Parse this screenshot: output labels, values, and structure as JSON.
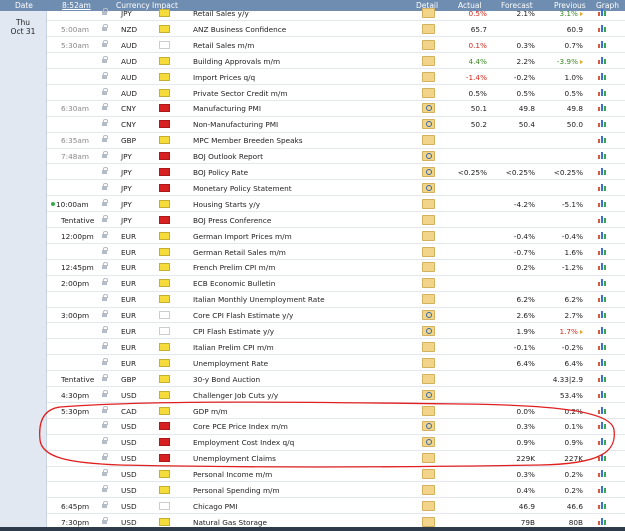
{
  "header": {
    "date_label": "Date",
    "time_label": "8:52am",
    "currency_label": "Currency",
    "impact_label": "Impact",
    "detail_label": "Detail",
    "actual_label": "Actual",
    "forecast_label": "Forecast",
    "previous_label": "Previous",
    "graph_label": "Graph"
  },
  "day": {
    "weekday": "Thu",
    "date": "Oct 31"
  },
  "colors": {
    "impact_low": "#f5dc3a",
    "impact_medium": "#f0903a",
    "impact_high": "#d72020",
    "better": "#3a8a24",
    "worse": "#d0281b",
    "header_bg": "#6f8db0",
    "annotation": "#e02020"
  },
  "events": [
    {
      "time": "",
      "currency": "JPY",
      "impact": "low",
      "event": "Retail Sales y/y",
      "actual": "0.5%",
      "actual_color": "red",
      "forecast": "2.1%",
      "previous": "3.1%",
      "previous_color": "green",
      "revised": true,
      "detail": "folder"
    },
    {
      "time": "5:00am",
      "currency": "NZD",
      "impact": "low",
      "event": "ANZ Business Confidence",
      "actual": "65.7",
      "actual_color": "",
      "forecast": "",
      "previous": "60.9",
      "previous_color": "",
      "revised": false,
      "detail": "folder"
    },
    {
      "time": "5:30am",
      "currency": "AUD",
      "impact": "medium",
      "event": "Retail Sales m/m",
      "actual": "0.1%",
      "actual_color": "red",
      "forecast": "0.3%",
      "previous": "0.7%",
      "previous_color": "",
      "revised": false,
      "detail": "folder"
    },
    {
      "time": "",
      "currency": "AUD",
      "impact": "low",
      "event": "Building Approvals m/m",
      "actual": "4.4%",
      "actual_color": "green",
      "forecast": "2.2%",
      "previous": "-3.9%",
      "previous_color": "green",
      "revised": true,
      "detail": "folder"
    },
    {
      "time": "",
      "currency": "AUD",
      "impact": "low",
      "event": "Import Prices q/q",
      "actual": "-1.4%",
      "actual_color": "red",
      "forecast": "-0.2%",
      "previous": "1.0%",
      "previous_color": "",
      "revised": false,
      "detail": "folder"
    },
    {
      "time": "",
      "currency": "AUD",
      "impact": "low",
      "event": "Private Sector Credit m/m",
      "actual": "0.5%",
      "actual_color": "",
      "forecast": "0.5%",
      "previous": "0.5%",
      "previous_color": "",
      "revised": false,
      "detail": "folder"
    },
    {
      "time": "6:30am",
      "currency": "CNY",
      "impact": "high",
      "event": "Manufacturing PMI",
      "actual": "50.1",
      "actual_color": "",
      "forecast": "49.8",
      "previous": "49.8",
      "previous_color": "",
      "revised": false,
      "detail": "magnifier"
    },
    {
      "time": "",
      "currency": "CNY",
      "impact": "high",
      "event": "Non-Manufacturing PMI",
      "actual": "50.2",
      "actual_color": "",
      "forecast": "50.4",
      "previous": "50.0",
      "previous_color": "",
      "revised": false,
      "detail": "magnifier"
    },
    {
      "time": "6:35am",
      "currency": "GBP",
      "impact": "low",
      "event": "MPC Member Breeden Speaks",
      "actual": "",
      "actual_color": "",
      "forecast": "",
      "previous": "",
      "previous_color": "",
      "revised": false,
      "detail": "folder"
    },
    {
      "time": "7:48am",
      "currency": "JPY",
      "impact": "high",
      "event": "BOJ Outlook Report",
      "actual": "",
      "actual_color": "",
      "forecast": "",
      "previous": "",
      "previous_color": "",
      "revised": false,
      "detail": "magnifier"
    },
    {
      "time": "",
      "currency": "JPY",
      "impact": "high",
      "event": "BOJ Policy Rate",
      "actual": "<0.25%",
      "actual_color": "",
      "forecast": "<0.25%",
      "previous": "<0.25%",
      "previous_color": "",
      "revised": false,
      "detail": "magnifier"
    },
    {
      "time": "",
      "currency": "JPY",
      "impact": "high",
      "event": "Monetary Policy Statement",
      "actual": "",
      "actual_color": "",
      "forecast": "",
      "previous": "",
      "previous_color": "",
      "revised": false,
      "detail": "magnifier"
    },
    {
      "time": "10:00am",
      "currency": "JPY",
      "impact": "low",
      "event": "Housing Starts y/y",
      "actual": "",
      "actual_color": "",
      "forecast": "-4.2%",
      "previous": "-5.1%",
      "previous_color": "",
      "revised": false,
      "detail": "folder",
      "upcoming": true
    },
    {
      "time": "Tentative",
      "currency": "JPY",
      "impact": "high",
      "event": "BOJ Press Conference",
      "actual": "",
      "actual_color": "",
      "forecast": "",
      "previous": "",
      "previous_color": "",
      "revised": false,
      "detail": "folder"
    },
    {
      "time": "12:00pm",
      "currency": "EUR",
      "impact": "low",
      "event": "German Import Prices m/m",
      "actual": "",
      "actual_color": "",
      "forecast": "-0.4%",
      "previous": "-0.4%",
      "previous_color": "",
      "revised": false,
      "detail": "folder"
    },
    {
      "time": "",
      "currency": "EUR",
      "impact": "low",
      "event": "German Retail Sales m/m",
      "actual": "",
      "actual_color": "",
      "forecast": "-0.7%",
      "previous": "1.6%",
      "previous_color": "",
      "revised": false,
      "detail": "folder"
    },
    {
      "time": "12:45pm",
      "currency": "EUR",
      "impact": "low",
      "event": "French Prelim CPI m/m",
      "actual": "",
      "actual_color": "",
      "forecast": "0.2%",
      "previous": "-1.2%",
      "previous_color": "",
      "revised": false,
      "detail": "folder"
    },
    {
      "time": "2:00pm",
      "currency": "EUR",
      "impact": "low",
      "event": "ECB Economic Bulletin",
      "actual": "",
      "actual_color": "",
      "forecast": "",
      "previous": "",
      "previous_color": "",
      "revised": false,
      "detail": "folder"
    },
    {
      "time": "",
      "currency": "EUR",
      "impact": "low",
      "event": "Italian Monthly Unemployment Rate",
      "actual": "",
      "actual_color": "",
      "forecast": "6.2%",
      "previous": "6.2%",
      "previous_color": "",
      "revised": false,
      "detail": "folder"
    },
    {
      "time": "3:00pm",
      "currency": "EUR",
      "impact": "medium",
      "event": "Core CPI Flash Estimate y/y",
      "actual": "",
      "actual_color": "",
      "forecast": "2.6%",
      "previous": "2.7%",
      "previous_color": "",
      "revised": false,
      "detail": "magnifier"
    },
    {
      "time": "",
      "currency": "EUR",
      "impact": "medium",
      "event": "CPI Flash Estimate y/y",
      "actual": "",
      "actual_color": "",
      "forecast": "1.9%",
      "previous": "1.7%",
      "previous_color": "red",
      "revised": true,
      "detail": "magnifier"
    },
    {
      "time": "",
      "currency": "EUR",
      "impact": "low",
      "event": "Italian Prelim CPI m/m",
      "actual": "",
      "actual_color": "",
      "forecast": "-0.1%",
      "previous": "-0.2%",
      "previous_color": "",
      "revised": false,
      "detail": "folder"
    },
    {
      "time": "",
      "currency": "EUR",
      "impact": "low",
      "event": "Unemployment Rate",
      "actual": "",
      "actual_color": "",
      "forecast": "6.4%",
      "previous": "6.4%",
      "previous_color": "",
      "revised": false,
      "detail": "folder"
    },
    {
      "time": "Tentative",
      "currency": "GBP",
      "impact": "low",
      "event": "30-y Bond Auction",
      "actual": "",
      "actual_color": "",
      "forecast": "",
      "previous": "4.33|2.9",
      "previous_color": "",
      "revised": false,
      "detail": "folder"
    },
    {
      "time": "4:30pm",
      "currency": "USD",
      "impact": "low",
      "event": "Challenger Job Cuts y/y",
      "actual": "",
      "actual_color": "",
      "forecast": "",
      "previous": "53.4%",
      "previous_color": "",
      "revised": false,
      "detail": "magnifier"
    },
    {
      "time": "5:30pm",
      "currency": "CAD",
      "impact": "low",
      "event": "GDP m/m",
      "actual": "",
      "actual_color": "",
      "forecast": "0.0%",
      "previous": "0.2%",
      "previous_color": "",
      "revised": false,
      "detail": "folder"
    },
    {
      "time": "",
      "currency": "USD",
      "impact": "high",
      "event": "Core PCE Price Index m/m",
      "actual": "",
      "actual_color": "",
      "forecast": "0.3%",
      "previous": "0.1%",
      "previous_color": "",
      "revised": false,
      "detail": "magnifier"
    },
    {
      "time": "",
      "currency": "USD",
      "impact": "high",
      "event": "Employment Cost Index q/q",
      "actual": "",
      "actual_color": "",
      "forecast": "0.9%",
      "previous": "0.9%",
      "previous_color": "",
      "revised": false,
      "detail": "magnifier"
    },
    {
      "time": "",
      "currency": "USD",
      "impact": "high",
      "event": "Unemployment Claims",
      "actual": "",
      "actual_color": "",
      "forecast": "229K",
      "previous": "227K",
      "previous_color": "",
      "revised": false,
      "detail": "folder"
    },
    {
      "time": "",
      "currency": "USD",
      "impact": "low",
      "event": "Personal Income m/m",
      "actual": "",
      "actual_color": "",
      "forecast": "0.3%",
      "previous": "0.2%",
      "previous_color": "",
      "revised": false,
      "detail": "folder"
    },
    {
      "time": "",
      "currency": "USD",
      "impact": "low",
      "event": "Personal Spending m/m",
      "actual": "",
      "actual_color": "",
      "forecast": "0.4%",
      "previous": "0.2%",
      "previous_color": "",
      "revised": false,
      "detail": "folder"
    },
    {
      "time": "6:45pm",
      "currency": "USD",
      "impact": "medium",
      "event": "Chicago PMI",
      "actual": "",
      "actual_color": "",
      "forecast": "46.9",
      "previous": "46.6",
      "previous_color": "",
      "revised": false,
      "detail": "folder"
    },
    {
      "time": "7:30pm",
      "currency": "USD",
      "impact": "low",
      "event": "Natural Gas Storage",
      "actual": "",
      "actual_color": "",
      "forecast": "79B",
      "previous": "80B",
      "previous_color": "",
      "revised": false,
      "detail": "folder"
    }
  ]
}
